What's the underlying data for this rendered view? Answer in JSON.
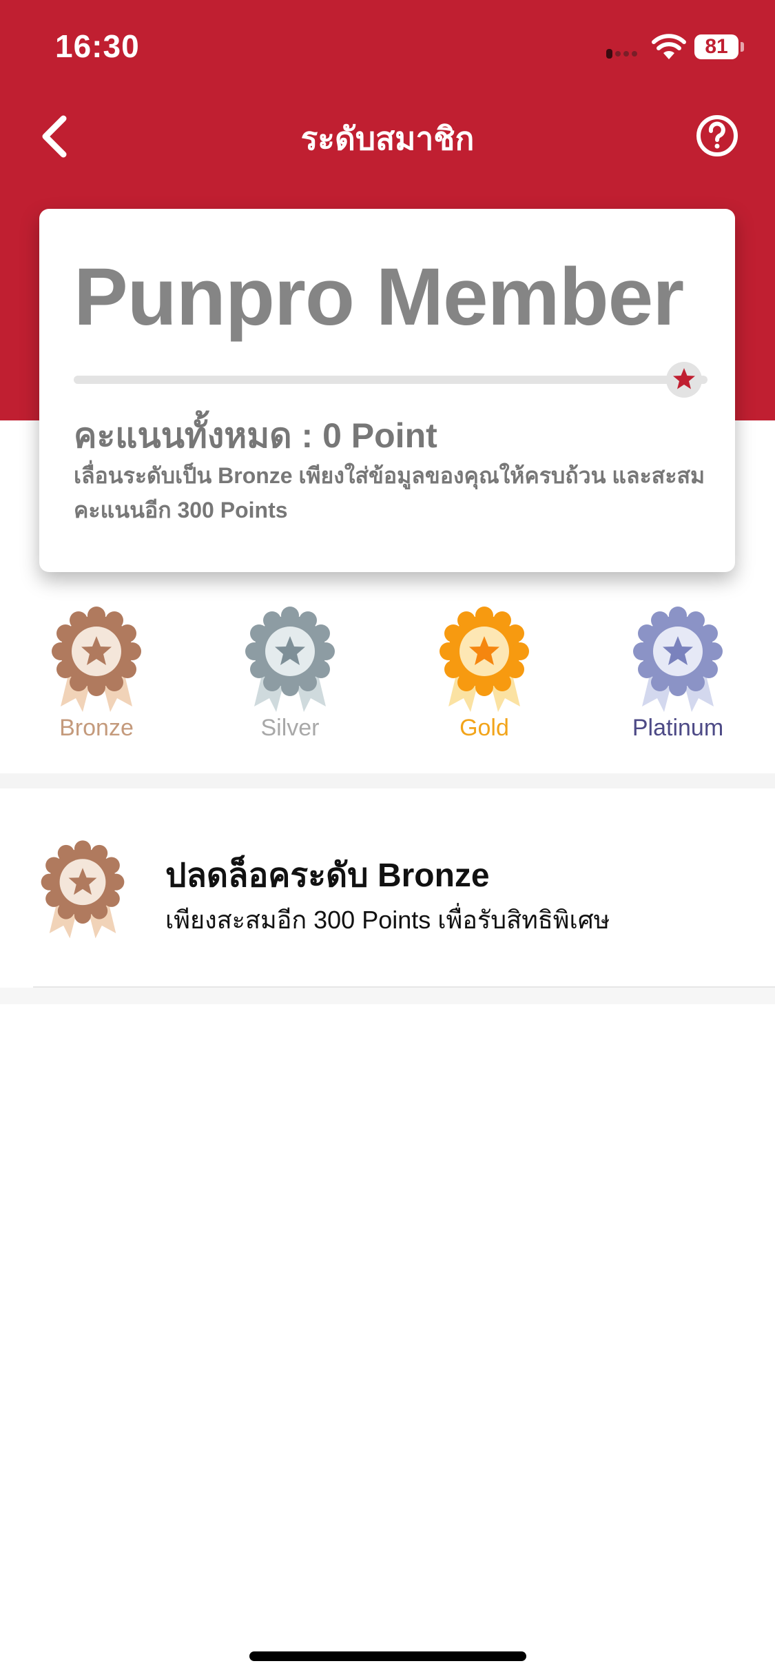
{
  "status_bar": {
    "time": "16:30",
    "battery": "81"
  },
  "nav": {
    "title": "ระดับสมาชิก",
    "back_icon": "chevron-left-icon",
    "help_icon": "question-circle-icon"
  },
  "card": {
    "member_title": "Punpro Member",
    "progress": 0,
    "points_total": "คะแนนทั้งหมด : 0 Point",
    "points_desc": "เลื่อนระดับเป็น Bronze เพียงใส่ข้อมูลของคุณให้ครบถ้วน และสะสมคะแนนอีก 300 Points"
  },
  "tiers": [
    {
      "label": "Bronze",
      "color": "#c49a7c",
      "outer": "#b07a5e",
      "ribbon": "#f1d3b8"
    },
    {
      "label": "Silver",
      "color": "#a8a8a8",
      "outer": "#8d9ca3",
      "ribbon": "#cfdadd"
    },
    {
      "label": "Gold",
      "color": "#f2a41a",
      "outer": "#f79a10",
      "ribbon": "#fbe2a2"
    },
    {
      "label": "Platinum",
      "color": "#4d4a86",
      "outer": "#8b93c6",
      "ribbon": "#d3d8ee"
    }
  ],
  "unlock": {
    "title": "ปลดล็อคระดับ Bronze",
    "subtitle": "เพียงสะสมอีก 300 Points เพื่อรับสิทธิพิเศษ"
  },
  "colors": {
    "brand_red": "#c01f31"
  }
}
